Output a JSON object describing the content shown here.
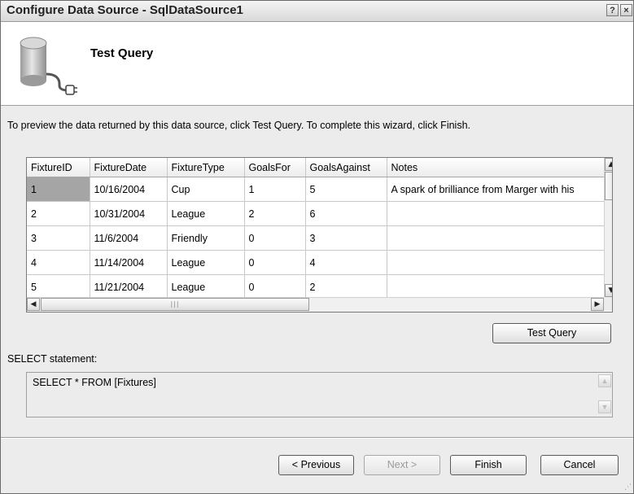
{
  "window": {
    "title": "Configure Data Source - SqlDataSource1",
    "help_label": "?",
    "close_label": "×"
  },
  "header": {
    "title": "Test Query",
    "icon": "database-icon"
  },
  "instruction": "To preview the data returned by this data source, click Test Query. To complete this wizard, click Finish.",
  "grid": {
    "columns": [
      "FixtureID",
      "FixtureDate",
      "FixtureType",
      "GoalsFor",
      "GoalsAgainst",
      "Notes"
    ],
    "rows": [
      [
        "1",
        "10/16/2004",
        "Cup",
        "1",
        "5",
        "A spark of brilliance from Marger with his"
      ],
      [
        "2",
        "10/31/2004",
        "League",
        "2",
        "6",
        ""
      ],
      [
        "3",
        "11/6/2004",
        "Friendly",
        "0",
        "3",
        ""
      ],
      [
        "4",
        "11/14/2004",
        "League",
        "0",
        "4",
        ""
      ],
      [
        "5",
        "11/21/2004",
        "League",
        "0",
        "2",
        ""
      ]
    ],
    "selected_cell": "row 1, FixtureID"
  },
  "test_query_label": "Test Query",
  "select_label": "SELECT statement:",
  "select_statement": "SELECT * FROM [Fixtures]",
  "buttons": {
    "previous": "< Previous",
    "next": "Next >",
    "finish": "Finish",
    "cancel": "Cancel"
  }
}
